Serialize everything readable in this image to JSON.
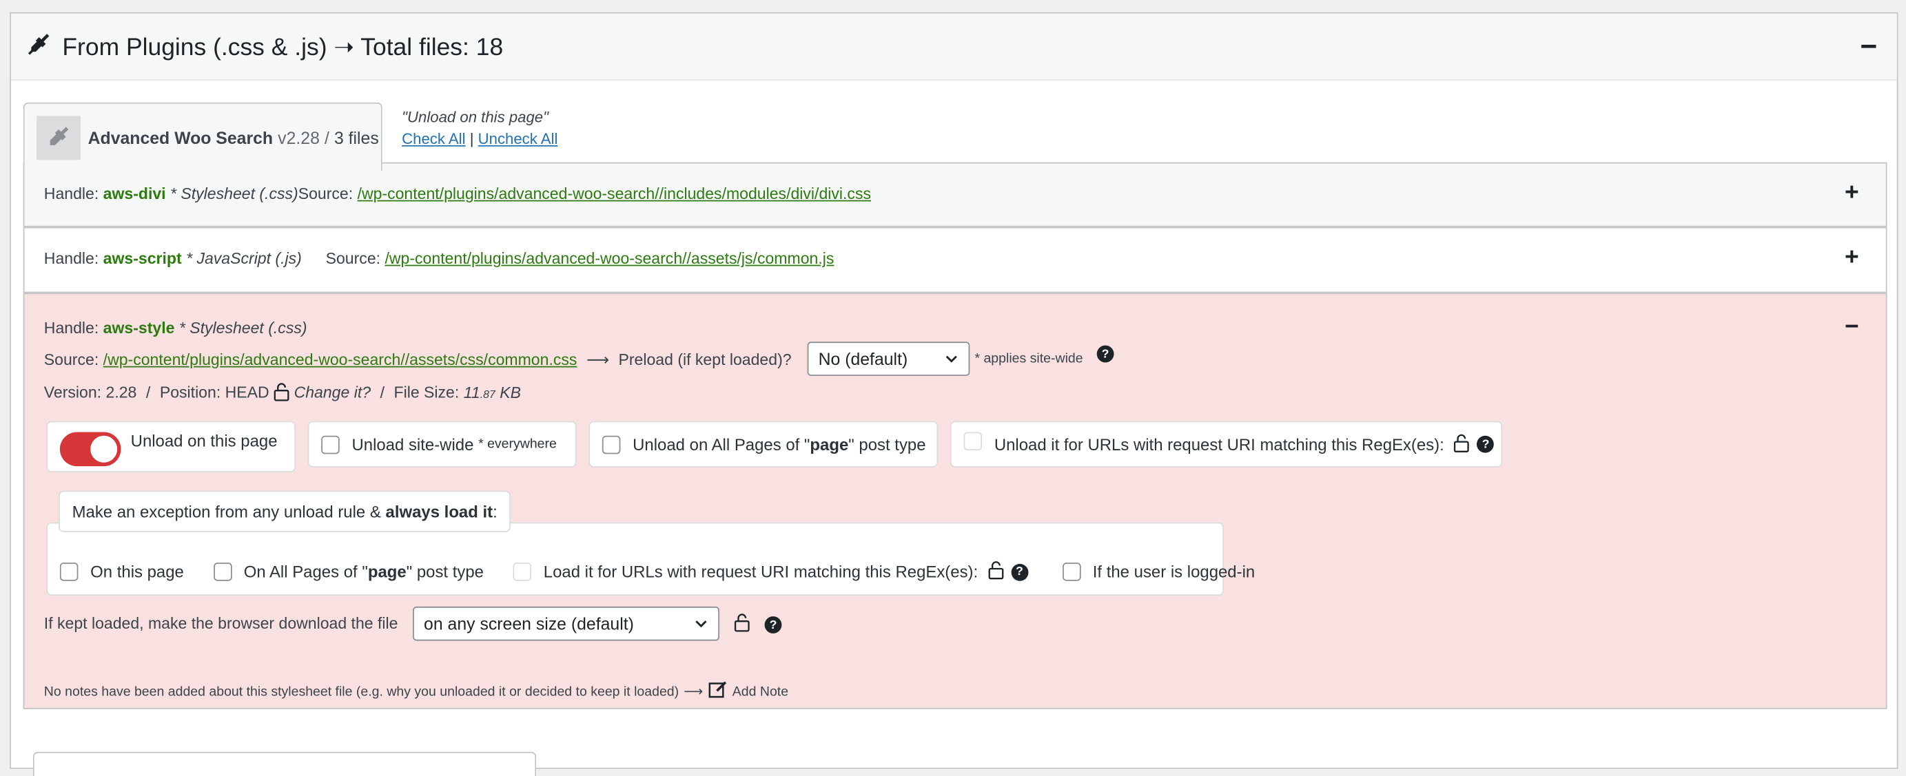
{
  "section": {
    "title": "From Plugins (.css & .js) ➝ Total files: 18",
    "collapse_symbol": "−"
  },
  "plugin": {
    "name": "Advanced Woo Search",
    "version": "v2.28",
    "separator": "/",
    "files": "3 files",
    "unload_quote": "\"Unload on this page\"",
    "check_all": "Check All",
    "link_sep": "|",
    "uncheck_all": "Uncheck All"
  },
  "rows": [
    {
      "handle_label": "Handle:",
      "handle": "aws-divi",
      "type": "* Stylesheet (.css)",
      "source_label": "Source:",
      "source": "/wp-content/plugins/advanced-woo-search//includes/modules/divi/divi.css",
      "toggle": "+"
    },
    {
      "handle_label": "Handle:",
      "handle": "aws-script",
      "type": "* JavaScript (.js)",
      "source_label": "Source:",
      "source": "/wp-content/plugins/advanced-woo-search//assets/js/common.js",
      "toggle": "+"
    }
  ],
  "expanded": {
    "handle_label": "Handle:",
    "handle": "aws-style",
    "type": "* Stylesheet (.css)",
    "toggle": "−",
    "source_label": "Source:",
    "source": "/wp-content/plugins/advanced-woo-search//assets/css/common.css",
    "arrow": "⟶",
    "preload_label": "Preload (if kept loaded)?",
    "preload_value": "No (default)",
    "applies": "* applies site-wide",
    "version_label": "Version:",
    "version": "2.28",
    "position_label": "Position:",
    "position": "HEAD",
    "change_it": "Change it?",
    "filesize_label": "File Size:",
    "filesize_main": "11",
    "filesize_dec": ".87",
    "filesize_unit": "KB",
    "slash": "/",
    "unload_page": "Unload on this page",
    "unload_sitewide": "Unload site-wide",
    "everywhere": "* everywhere",
    "unload_pages_pre": "Unload on All Pages of \"",
    "post_type": "page",
    "unload_pages_post": "\" post type",
    "unload_regex": "Unload it for URLs with request URI matching this RegEx(es):",
    "exception_pre": "Make an exception from any unload rule &",
    "exception_bold": "always load it",
    "exception_post": ":",
    "on_this_page": "On this page",
    "on_all_pages_pre": "On All Pages of \"",
    "on_all_pages_post": "\" post type",
    "load_regex": "Load it for URLs with request URI matching this RegEx(es):",
    "logged_in": "If the user is logged-in",
    "download_label": "If kept loaded, make the browser download the file",
    "download_value": "on any screen size (default)",
    "notes": "No notes have been added about this stylesheet file (e.g. why you unloaded it or decided to keep it loaded)",
    "add_note": "Add Note",
    "toggle_state": true,
    "colors": {
      "danger": "#d63638",
      "expanded_bg": "#f9e1e1",
      "handle": "#2c7a10",
      "link": "#2271b1"
    }
  },
  "icons": [
    "plug-icon",
    "plugin-placeholder-icon",
    "lock-icon",
    "help-icon",
    "chevron-down-icon",
    "note-icon"
  ]
}
